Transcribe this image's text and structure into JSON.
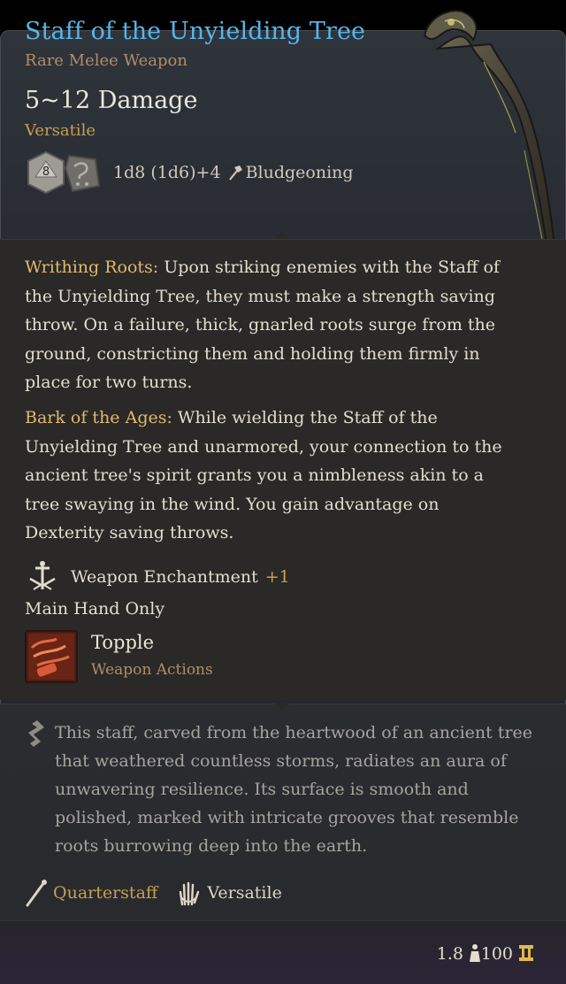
{
  "item": {
    "name": "Staff of the Unyielding Tree",
    "rarity": "Rare Melee Weapon",
    "damage": "5~12 Damage",
    "property": "Versatile",
    "die_label": "8",
    "dice_text": "1d8 (1d6)+4",
    "damage_type": "Bludgeoning"
  },
  "passives": [
    {
      "name": "Writhing Roots:",
      "text": " Upon striking enemies with the Staff of the Unyielding Tree, they must make a strength saving throw. On a failure, thick, gnarled roots surge from the ground, constricting them and holding them firmly in place for two turns."
    },
    {
      "name": "Bark of the Ages:",
      "text": " While wielding the Staff of the Unyielding Tree and unarmored, your connection to the ancient tree's spirit grants you a nimbleness akin to a tree swaying in the wind. You gain advantage on Dexterity saving throws."
    }
  ],
  "enchantment": {
    "label": "Weapon Enchantment",
    "bonus": "+1"
  },
  "restriction": "Main Hand Only",
  "action": {
    "name": "Topple",
    "category": "Weapon Actions"
  },
  "lore": "This staff, carved from the heartwood of an ancient tree that weathered countless storms, radiates an aura of unwavering resilience. Its surface is smooth and polished, marked with intricate grooves that resemble roots burrowing deep into the earth.",
  "tags": {
    "weapon_type": "Quarterstaff",
    "handedness": "Versatile"
  },
  "footer": {
    "weight": "1.8",
    "value": "100"
  },
  "colors": {
    "title": "#56b6ea",
    "rarity": "#b08e66",
    "highlight": "#c89f50",
    "passive_name": "#e1b96b"
  },
  "icons": {
    "dice": "d8-d6-dice-icon",
    "damage_type": "hammer-icon",
    "enchantment": "sword-enchant-icon",
    "action": "topple-icon",
    "lore": "feather-icon",
    "weapon_type": "staff-icon",
    "handedness": "hand-icon",
    "weight": "weight-icon",
    "value": "coin-icon"
  }
}
